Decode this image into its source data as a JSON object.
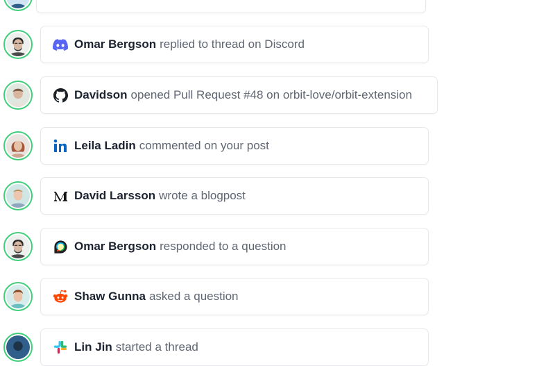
{
  "activity": [
    {
      "name": "",
      "action": "",
      "source_icon": "unknown-icon",
      "avatar_bg": "#cfe3f2"
    },
    {
      "name": "Omar Bergson",
      "action": "replied to thread on Discord",
      "source_icon": "discord-icon",
      "avatar_bg": "#eef0ee"
    },
    {
      "name": "Davidson",
      "action": "opened Pull Request #48 on orbit-love/orbit-extension",
      "source_icon": "github-icon",
      "avatar_bg": "#dfe7df"
    },
    {
      "name": "Leila Ladin",
      "action": "commented on your post",
      "source_icon": "linkedin-icon",
      "avatar_bg": "#e9e4e0"
    },
    {
      "name": "David Larsson",
      "action": "wrote a blogpost",
      "source_icon": "medium-icon",
      "avatar_bg": "#cfe6e4"
    },
    {
      "name": "Omar Bergson",
      "action": "responded to a question",
      "source_icon": "discourse-icon",
      "avatar_bg": "#eef0ee"
    },
    {
      "name": "Shaw Gunna",
      "action": "asked a question",
      "source_icon": "reddit-icon",
      "avatar_bg": "#d6eceb"
    },
    {
      "name": "Lin Jin",
      "action": "started a thread",
      "source_icon": "slack-icon",
      "avatar_bg": "#2f5f8a"
    }
  ],
  "colors": {
    "avatar_ring": "#3fcf7a",
    "discord": "#5865F2",
    "github": "#1b1f24",
    "linkedin": "#0a66c2",
    "reddit": "#ff4500",
    "slack_teal": "#36c5f0"
  }
}
